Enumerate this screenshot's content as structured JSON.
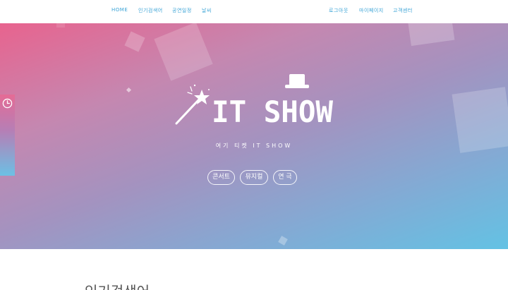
{
  "nav": {
    "left": [
      "HOME",
      "인기검색어",
      "공연일정",
      "날씨"
    ],
    "right": [
      "로그아웃",
      "마이페이지",
      "고객센터"
    ]
  },
  "hero": {
    "logo_text": "IT SHOW",
    "tagline": "여기 티켓 IT SHOW",
    "categories": [
      "콘서트",
      "뮤지컬",
      "연 극"
    ]
  },
  "sidebar": {
    "icon": "clock-icon"
  },
  "section": {
    "title": "인기검색어"
  },
  "colors": {
    "nav_link": "#3aa3d6",
    "hero_start": "#e8638e",
    "hero_end": "#63c2e4",
    "hero_text": "#ffffff"
  }
}
